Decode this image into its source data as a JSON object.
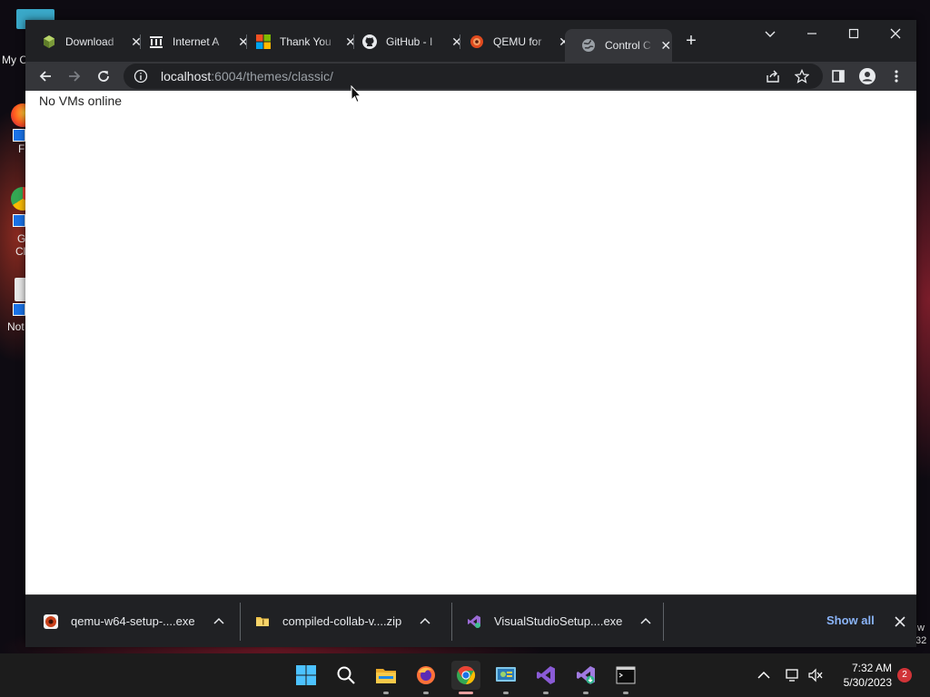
{
  "desktop": {
    "icons": [
      {
        "label": "My C"
      },
      {
        "label": "F"
      },
      {
        "label": "G"
      },
      {
        "label": "Cl"
      },
      {
        "label": "Not"
      }
    ],
    "right_text_1": "w",
    "right_text_2": "32"
  },
  "browser": {
    "tabs": [
      {
        "title": "Download",
        "icon": "cube-icon"
      },
      {
        "title": "Internet A",
        "icon": "archive-icon"
      },
      {
        "title": "Thank You",
        "icon": "microsoft-icon"
      },
      {
        "title": "GitHub - I",
        "icon": "github-icon"
      },
      {
        "title": "QEMU for",
        "icon": "qemu-icon"
      },
      {
        "title": "Control C",
        "icon": "globe-icon",
        "active": true
      }
    ],
    "address": {
      "host": "localhost",
      "path": ":6004/themes/classic/"
    },
    "page": {
      "message": "No VMs online"
    },
    "downloads": {
      "items": [
        {
          "name": "qemu-w64-setup-....exe",
          "icon": "qemu-icon"
        },
        {
          "name": "compiled-collab-v....zip",
          "icon": "zip-folder-icon"
        },
        {
          "name": "VisualStudioSetup....exe",
          "icon": "visual-studio-icon"
        }
      ],
      "show_all": "Show all"
    }
  },
  "taskbar": {
    "time": "7:32 AM",
    "date": "5/30/2023",
    "notification_count": "2"
  },
  "colors": {
    "chrome_dark": "#202124",
    "chrome_toolbar": "#35363a",
    "link_blue": "#8ab4f8"
  }
}
